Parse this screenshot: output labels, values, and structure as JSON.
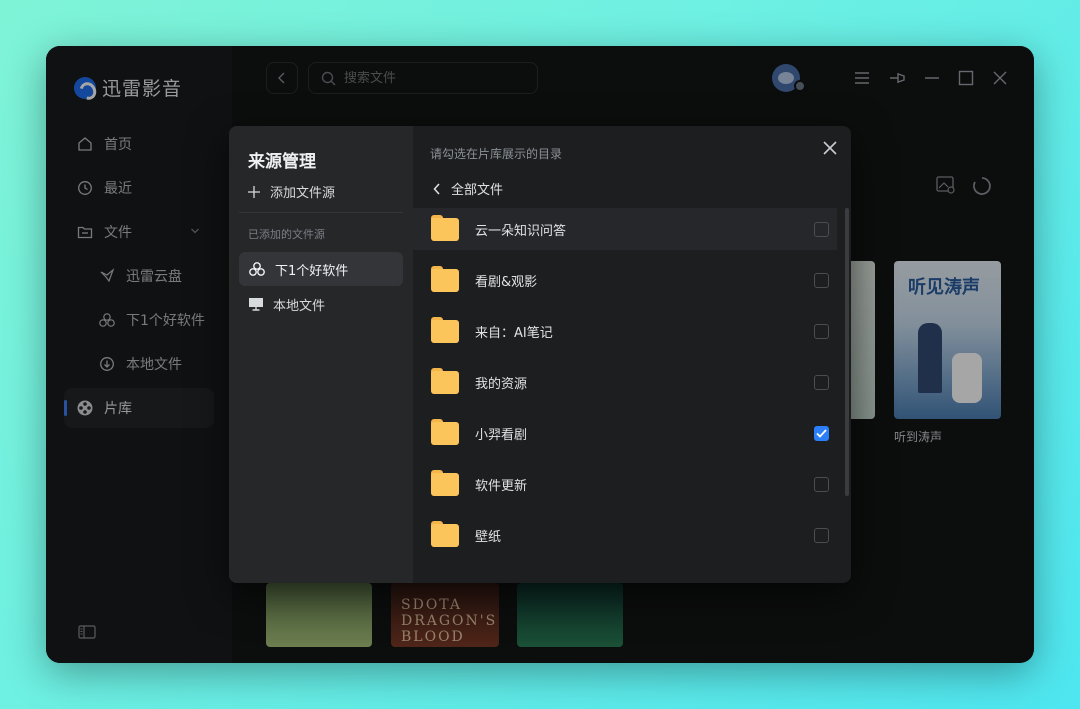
{
  "app": {
    "name": "迅雷影音"
  },
  "sidebar": {
    "items": [
      {
        "label": "首页",
        "icon": "home-icon"
      },
      {
        "label": "最近",
        "icon": "clock-icon"
      },
      {
        "label": "文件",
        "icon": "folder-icon"
      },
      {
        "label": "迅雷云盘",
        "icon": "cloud-bird-icon"
      },
      {
        "label": "下1个好软件",
        "icon": "share-cloud-icon"
      },
      {
        "label": "本地文件",
        "icon": "download-icon"
      },
      {
        "label": "片库",
        "icon": "film-reel-icon"
      }
    ]
  },
  "topbar": {
    "search_placeholder": "搜索文件"
  },
  "library": {
    "posters": [
      {
        "caption": "听到涛声",
        "art": "听见涛声"
      },
      {
        "caption": "",
        "art": "SDOTA DRAGON'S BLOOD"
      }
    ]
  },
  "modal": {
    "title": "来源管理",
    "add_source": "添加文件源",
    "added_label": "已添加的文件源",
    "sources": [
      {
        "label": "下1个好软件",
        "active": true
      },
      {
        "label": "本地文件",
        "active": false
      }
    ],
    "hint": "请勾选在片库展示的目录",
    "breadcrumb": "全部文件",
    "folders": [
      {
        "name": "云一朵知识问答",
        "checked": false
      },
      {
        "name": "看剧&观影",
        "checked": false
      },
      {
        "name": "来自：AI笔记",
        "checked": false
      },
      {
        "name": "我的资源",
        "checked": false
      },
      {
        "name": "小羿看剧",
        "checked": true
      },
      {
        "name": "软件更新",
        "checked": false
      },
      {
        "name": "壁纸",
        "checked": false
      }
    ]
  },
  "colors": {
    "accent": "#2d7ff9",
    "folder": "#fbc55b"
  }
}
